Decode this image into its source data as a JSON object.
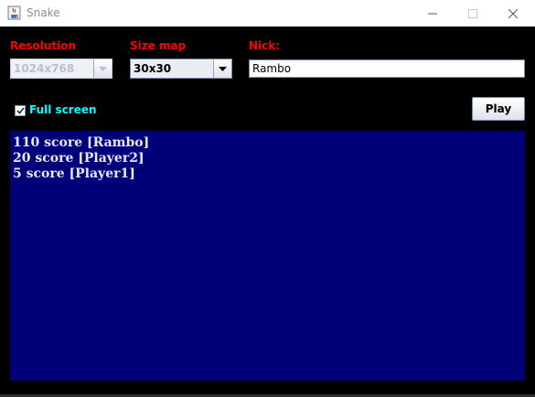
{
  "window": {
    "title": "Snake",
    "min_glyph": "—",
    "max_glyph": "☐",
    "close_glyph": "✕"
  },
  "labels": {
    "resolution": "Resolution",
    "size_map": "Size map",
    "nick": "Nick:"
  },
  "resolution_select": {
    "value": "1024x768",
    "enabled": false
  },
  "size_map_select": {
    "value": "30x30",
    "enabled": true
  },
  "nick_input": {
    "value": "Rambo"
  },
  "fullscreen": {
    "label": "Full screen",
    "checked": true
  },
  "play_button": {
    "label": "Play"
  },
  "scores": [
    "110 score [Rambo]",
    "20 score [Player2]",
    "5 score [Player1]"
  ],
  "colors": {
    "label_red": "#ff0000",
    "checkbox_label_cyan": "#00ffff",
    "score_panel_bg": "#000078",
    "score_text": "#e8e8ff"
  },
  "icons": {
    "app": "java-coffee-cup-icon",
    "dropdown": "triangle-down-icon",
    "check": "checkmark-icon"
  }
}
